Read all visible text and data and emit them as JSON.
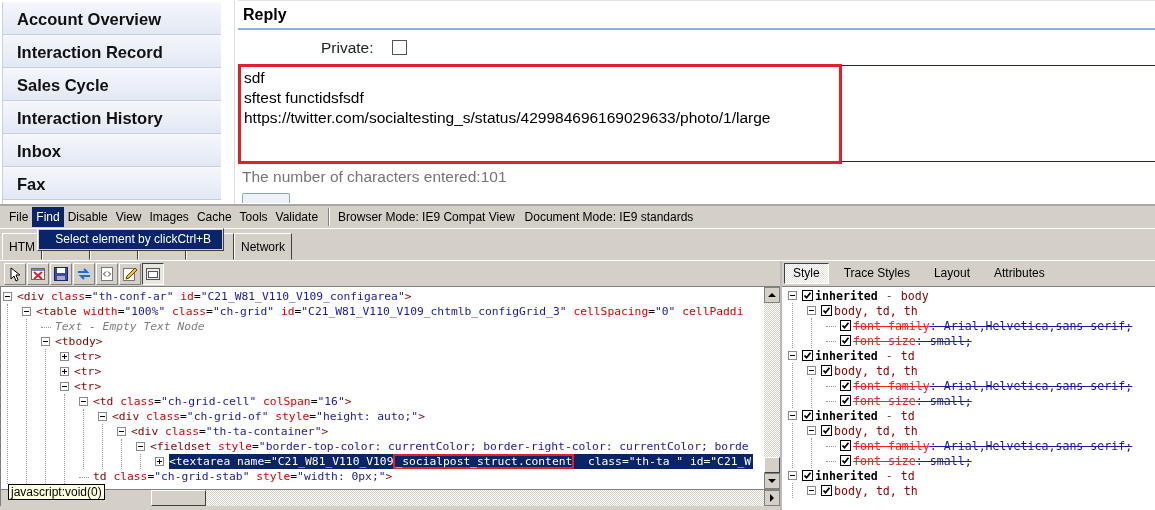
{
  "sidebar": {
    "items": [
      {
        "label": "Account Overview"
      },
      {
        "label": "Interaction Record"
      },
      {
        "label": "Sales Cycle"
      },
      {
        "label": "Interaction History"
      },
      {
        "label": "Inbox"
      },
      {
        "label": "Fax"
      }
    ]
  },
  "reply": {
    "title": "Reply",
    "private": {
      "label": "Private:",
      "checked": false
    },
    "field": {
      "value": "sdf\nsftest functidsfsdf\nhttps://twitter.com/socialtesting_s/status/429984696169029633/photo/1/large",
      "annotated": true
    },
    "counter": "The number of characters entered:101"
  },
  "devtools": {
    "menu": [
      {
        "label": "File",
        "open": false
      },
      {
        "label": "Find",
        "open": true,
        "items": [
          {
            "label": "Select element by click",
            "shortcut": "Ctrl+B",
            "selected": true
          }
        ]
      },
      {
        "label": "Disable",
        "open": false
      },
      {
        "label": "View",
        "open": false
      },
      {
        "label": "Images",
        "open": false
      },
      {
        "label": "Cache",
        "open": false
      },
      {
        "label": "Tools",
        "open": false
      },
      {
        "label": "Validate",
        "open": false
      }
    ],
    "modes": [
      "Browser Mode:  IE9 Compat View",
      "Document Mode:  IE9 standards"
    ],
    "tabs": [
      {
        "kind": "labelled",
        "label": "HTM"
      },
      {
        "kind": "covered"
      },
      {
        "kind": "covered"
      },
      {
        "kind": "covered"
      },
      {
        "kind": "covered"
      },
      {
        "kind": "labelled",
        "label": "Network"
      }
    ],
    "toolbar": [
      {
        "kind": "pointer",
        "pressed": false
      },
      {
        "kind": "clear",
        "pressed": false
      },
      {
        "kind": "save",
        "pressed": false
      },
      {
        "kind": "refresh",
        "pressed": false
      },
      {
        "kind": "source",
        "pressed": false
      },
      {
        "kind": "edit",
        "pressed": false
      },
      {
        "kind": "wrap",
        "pressed": true
      }
    ],
    "dom_tree": [
      {
        "expanded": true,
        "selected": false,
        "tokens": [
          {
            "kind": "tag",
            "text": "<div"
          },
          {
            "kind": "attr",
            "text": " class"
          },
          {
            "kind": "punct",
            "text": "="
          },
          {
            "kind": "value",
            "text": "\"th-conf-ar\""
          },
          {
            "kind": "attr",
            "text": " id"
          },
          {
            "kind": "punct",
            "text": "="
          },
          {
            "kind": "value",
            "text": "\"C21_W81_V110_V109_configarea\""
          },
          {
            "kind": "tag",
            "text": ">"
          }
        ],
        "children": [
          {
            "expanded": true,
            "selected": false,
            "tokens": [
              {
                "kind": "tag",
                "text": "<table"
              },
              {
                "kind": "attr",
                "text": " width"
              },
              {
                "kind": "punct",
                "text": "="
              },
              {
                "kind": "value",
                "text": "\"100%\""
              },
              {
                "kind": "attr",
                "text": " class"
              },
              {
                "kind": "punct",
                "text": "="
              },
              {
                "kind": "value",
                "text": "\"ch-grid\""
              },
              {
                "kind": "attr",
                "text": " id"
              },
              {
                "kind": "punct",
                "text": "="
              },
              {
                "kind": "value",
                "text": "\"C21_W81_V110_V109_chtmlb_configGrid_3\""
              },
              {
                "kind": "attr",
                "text": " cellSpacing"
              },
              {
                "kind": "punct",
                "text": "="
              },
              {
                "kind": "value",
                "text": "\"0\""
              },
              {
                "kind": "attr",
                "text": " cellPaddi"
              }
            ],
            "children": [
              {
                "selected": false,
                "tokens": [
                  {
                    "kind": "comment",
                    "text": "Text - Empty Text Node"
                  }
                ]
              },
              {
                "expanded": true,
                "selected": false,
                "tokens": [
                  {
                    "kind": "tag",
                    "text": "<tbody>"
                  }
                ],
                "children": [
                  {
                    "expanded": false,
                    "selected": false,
                    "tokens": [
                      {
                        "kind": "tag",
                        "text": "<tr>"
                      }
                    ]
                  },
                  {
                    "expanded": false,
                    "selected": false,
                    "tokens": [
                      {
                        "kind": "tag",
                        "text": "<tr>"
                      }
                    ]
                  },
                  {
                    "expanded": true,
                    "selected": false,
                    "tokens": [
                      {
                        "kind": "tag",
                        "text": "<tr>"
                      }
                    ],
                    "children": [
                      {
                        "expanded": true,
                        "selected": false,
                        "tokens": [
                          {
                            "kind": "tag",
                            "text": "<td"
                          },
                          {
                            "kind": "attr",
                            "text": " class"
                          },
                          {
                            "kind": "punct",
                            "text": "="
                          },
                          {
                            "kind": "value",
                            "text": "\"ch-grid-cell\""
                          },
                          {
                            "kind": "attr",
                            "text": " colSpan"
                          },
                          {
                            "kind": "punct",
                            "text": "="
                          },
                          {
                            "kind": "value",
                            "text": "\"16\""
                          },
                          {
                            "kind": "tag",
                            "text": ">"
                          }
                        ],
                        "children": [
                          {
                            "expanded": true,
                            "selected": false,
                            "tokens": [
                              {
                                "kind": "tag",
                                "text": "<div"
                              },
                              {
                                "kind": "attr",
                                "text": " class"
                              },
                              {
                                "kind": "punct",
                                "text": "="
                              },
                              {
                                "kind": "value",
                                "text": "\"ch-grid-of\""
                              },
                              {
                                "kind": "attr",
                                "text": " style"
                              },
                              {
                                "kind": "punct",
                                "text": "="
                              },
                              {
                                "kind": "value",
                                "text": "\"height: auto;\""
                              },
                              {
                                "kind": "tag",
                                "text": ">"
                              }
                            ],
                            "children": [
                              {
                                "expanded": true,
                                "selected": false,
                                "tokens": [
                                  {
                                    "kind": "tag",
                                    "text": "<div"
                                  },
                                  {
                                    "kind": "attr",
                                    "text": " class"
                                  },
                                  {
                                    "kind": "punct",
                                    "text": "="
                                  },
                                  {
                                    "kind": "value",
                                    "text": "\"th-ta-container\""
                                  },
                                  {
                                    "kind": "tag",
                                    "text": ">"
                                  }
                                ],
                                "children": [
                                  {
                                    "expanded": true,
                                    "selected": false,
                                    "tokens": [
                                      {
                                        "kind": "tag",
                                        "text": "<fieldset"
                                      },
                                      {
                                        "kind": "attr",
                                        "text": " style"
                                      },
                                      {
                                        "kind": "punct",
                                        "text": "="
                                      },
                                      {
                                        "kind": "value",
                                        "text": "\"border-top-color: currentColor; border-right-color: currentColor; borde"
                                      }
                                    ],
                                    "children": [
                                      {
                                        "expanded": false,
                                        "selected": true,
                                        "tokens": [
                                          {
                                            "text": "<textarea name=\"C21_W81_V110_V109",
                                            "marked": false
                                          },
                                          {
                                            "text": "_socialpost_struct.content",
                                            "marked": true
                                          },
                                          {
                                            "text": "  class=\"th-ta \" id=\"C21_W",
                                            "marked": false
                                          }
                                        ]
                                      }
                                    ]
                                  }
                                ]
                              }
                            ]
                          }
                        ]
                      },
                      {
                        "selected": false,
                        "tokens": [
                          {
                            "kind": "tag",
                            "text": "td"
                          },
                          {
                            "kind": "attr",
                            "text": " class"
                          },
                          {
                            "kind": "punct",
                            "text": "="
                          },
                          {
                            "kind": "value",
                            "text": "\"ch-grid-stab\""
                          },
                          {
                            "kind": "attr",
                            "text": " style"
                          },
                          {
                            "kind": "punct",
                            "text": "="
                          },
                          {
                            "kind": "value",
                            "text": "\"width: 0px;\""
                          },
                          {
                            "kind": "tag",
                            "text": ">"
                          }
                        ]
                      }
                    ]
                  }
                ]
              }
            ]
          }
        ]
      }
    ],
    "tooltip": "javascript:void(0)",
    "style_tabs": [
      {
        "label": "Style",
        "selected": true
      },
      {
        "label": "Trace Styles",
        "selected": false
      },
      {
        "label": "Layout",
        "selected": false
      },
      {
        "label": "Attributes",
        "selected": false
      }
    ],
    "style_tree": [
      {
        "checked": true,
        "expanded": true,
        "label": "inherited",
        "dash": "-",
        "element": "body",
        "rules": [
          {
            "checked": true,
            "expanded": true,
            "selector": "body, td, th",
            "properties": [
              {
                "checked": true,
                "overridden": true,
                "name": "font-family",
                "value": ": Arial,Helvetica,sans-serif;"
              },
              {
                "checked": true,
                "overridden": true,
                "name": "font-size",
                "value": ": small;"
              }
            ]
          }
        ]
      },
      {
        "checked": true,
        "expanded": true,
        "label": "inherited",
        "dash": "-",
        "element": "td",
        "rules": [
          {
            "checked": true,
            "expanded": true,
            "selector": "body, td, th",
            "properties": [
              {
                "checked": true,
                "overridden": true,
                "name": "font-family",
                "value": ": Arial,Helvetica,sans-serif;"
              },
              {
                "checked": true,
                "overridden": true,
                "name": "font-size",
                "value": ": small;"
              }
            ]
          }
        ]
      },
      {
        "checked": true,
        "expanded": true,
        "label": "inherited",
        "dash": "-",
        "element": "td",
        "rules": [
          {
            "checked": true,
            "expanded": true,
            "selector": "body, td, th",
            "properties": [
              {
                "checked": true,
                "overridden": true,
                "name": "font-family",
                "value": ": Arial,Helvetica,sans-serif;"
              },
              {
                "checked": true,
                "overridden": true,
                "name": "font-size",
                "value": ": small;"
              }
            ]
          }
        ]
      },
      {
        "checked": true,
        "expanded": true,
        "label": "inherited",
        "dash": "-",
        "element": "td",
        "rules": [
          {
            "checked": true,
            "expanded": true,
            "selector": "body, td, th"
          }
        ]
      }
    ]
  }
}
